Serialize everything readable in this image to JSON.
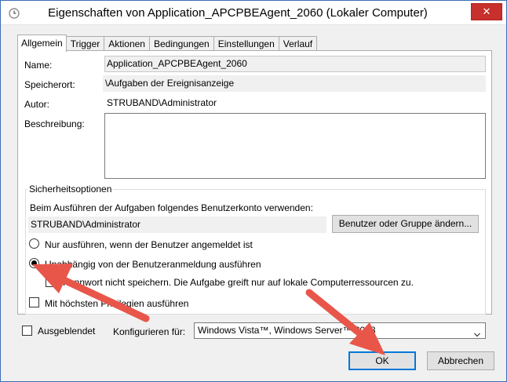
{
  "window": {
    "title": "Eigenschaften von Application_APCPBEAgent_2060 (Lokaler Computer)",
    "close_glyph": "✕"
  },
  "tabs": [
    {
      "label": "Allgemein",
      "active": true
    },
    {
      "label": "Trigger",
      "active": false
    },
    {
      "label": "Aktionen",
      "active": false
    },
    {
      "label": "Bedingungen",
      "active": false
    },
    {
      "label": "Einstellungen",
      "active": false
    },
    {
      "label": "Verlauf",
      "active": false
    }
  ],
  "general": {
    "name_label": "Name:",
    "name_value": "Application_APCPBEAgent_2060",
    "location_label": "Speicherort:",
    "location_value": "\\Aufgaben der Ereignisanzeige",
    "author_label": "Autor:",
    "author_value": "STRUBAND\\Administrator",
    "description_label": "Beschreibung:",
    "description_value": ""
  },
  "security": {
    "group_title": "Sicherheitsoptionen",
    "account_prompt": "Beim Ausführen der Aufgaben folgendes Benutzerkonto verwenden:",
    "account_value": "STRUBAND\\Administrator",
    "change_user_button": "Benutzer oder Gruppe ändern...",
    "radio_logged_on": "Nur ausführen, wenn der Benutzer angemeldet ist",
    "radio_independent": "Unabhängig von der Benutzeranmeldung ausführen",
    "no_password_checkbox": "Kennwort nicht speichern. Die Aufgabe greift nur auf lokale Computerressourcen zu.",
    "highest_privileges_checkbox": "Mit höchsten Privilegien ausführen"
  },
  "bottom": {
    "hidden_checkbox": "Ausgeblendet",
    "configure_label": "Konfigurieren für:",
    "configure_value": "Windows Vista™, Windows Server™ 2008"
  },
  "buttons": {
    "ok": "OK",
    "cancel": "Abbrechen"
  },
  "colors": {
    "annotation_arrow": "#e8564a",
    "window_border": "#3c6db3",
    "close_button": "#c7302c"
  }
}
